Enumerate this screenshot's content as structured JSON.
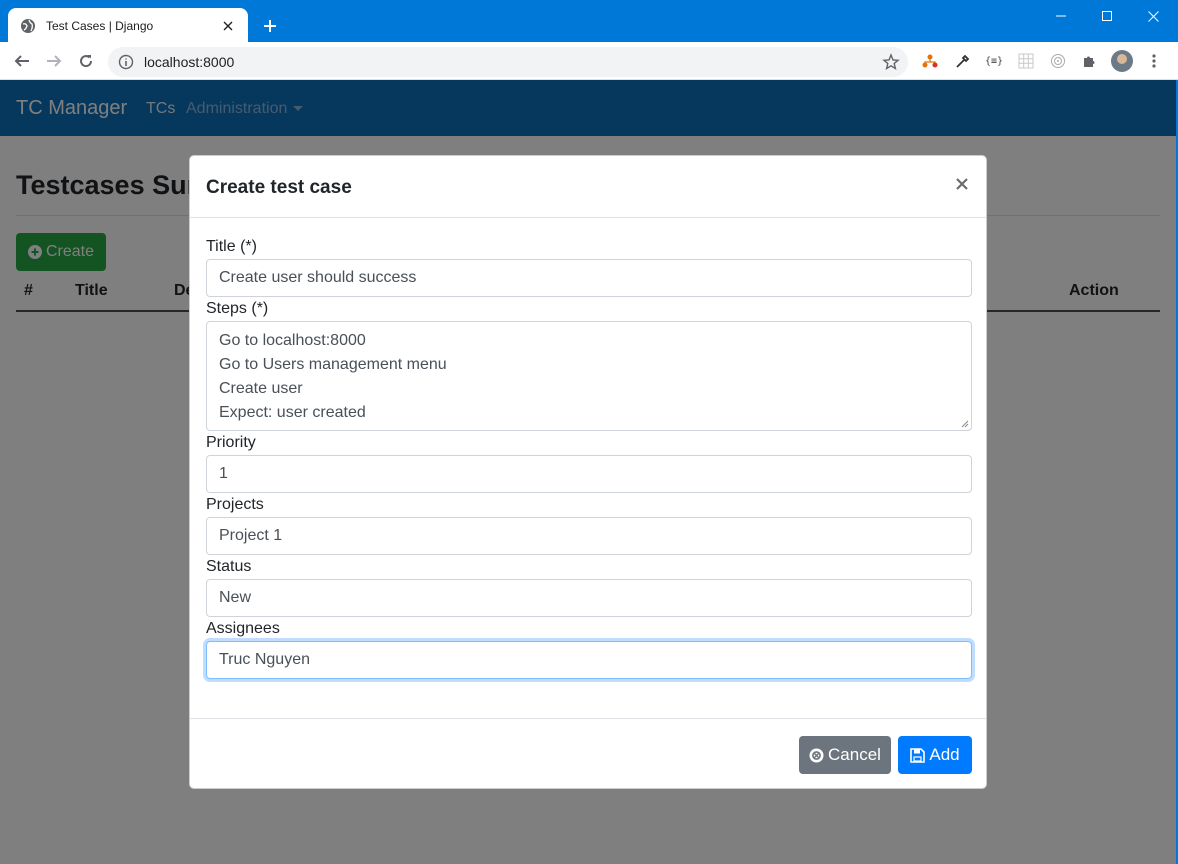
{
  "browser": {
    "tab_title": "Test Cases | Django",
    "url": "localhost:8000",
    "extensions": [
      "network-icon",
      "eyedropper-icon",
      "json-icon",
      "grid-icon",
      "target-icon",
      "puzzle-icon"
    ],
    "json_ext_label": "{≡}"
  },
  "navbar": {
    "brand": "TC Manager",
    "items": [
      {
        "label": "TCs"
      },
      {
        "label": "Administration"
      }
    ]
  },
  "page": {
    "title": "Testcases Summary",
    "create_label": "Create",
    "table_headers": [
      "#",
      "Title",
      "De",
      "Action"
    ]
  },
  "modal": {
    "title": "Create test case",
    "fields": {
      "title": {
        "label": "Title (*)",
        "value": "Create user should success"
      },
      "steps": {
        "label": "Steps (*)",
        "lines": [
          "Go to localhost:8000",
          "Go to Users management menu",
          "Create user",
          "Expect: user created"
        ]
      },
      "priority": {
        "label": "Priority",
        "value": "1"
      },
      "projects": {
        "label": "Projects",
        "value": "Project 1"
      },
      "status": {
        "label": "Status",
        "value": "New"
      },
      "assignees": {
        "label": "Assignees",
        "value": "Truc Nguyen"
      }
    },
    "cancel_label": "Cancel",
    "add_label": "Add"
  },
  "colors": {
    "titlebar": "#0078d7",
    "navbar": "#0d6fb8",
    "success": "#28a745",
    "primary": "#007bff",
    "secondary": "#6c757d"
  }
}
